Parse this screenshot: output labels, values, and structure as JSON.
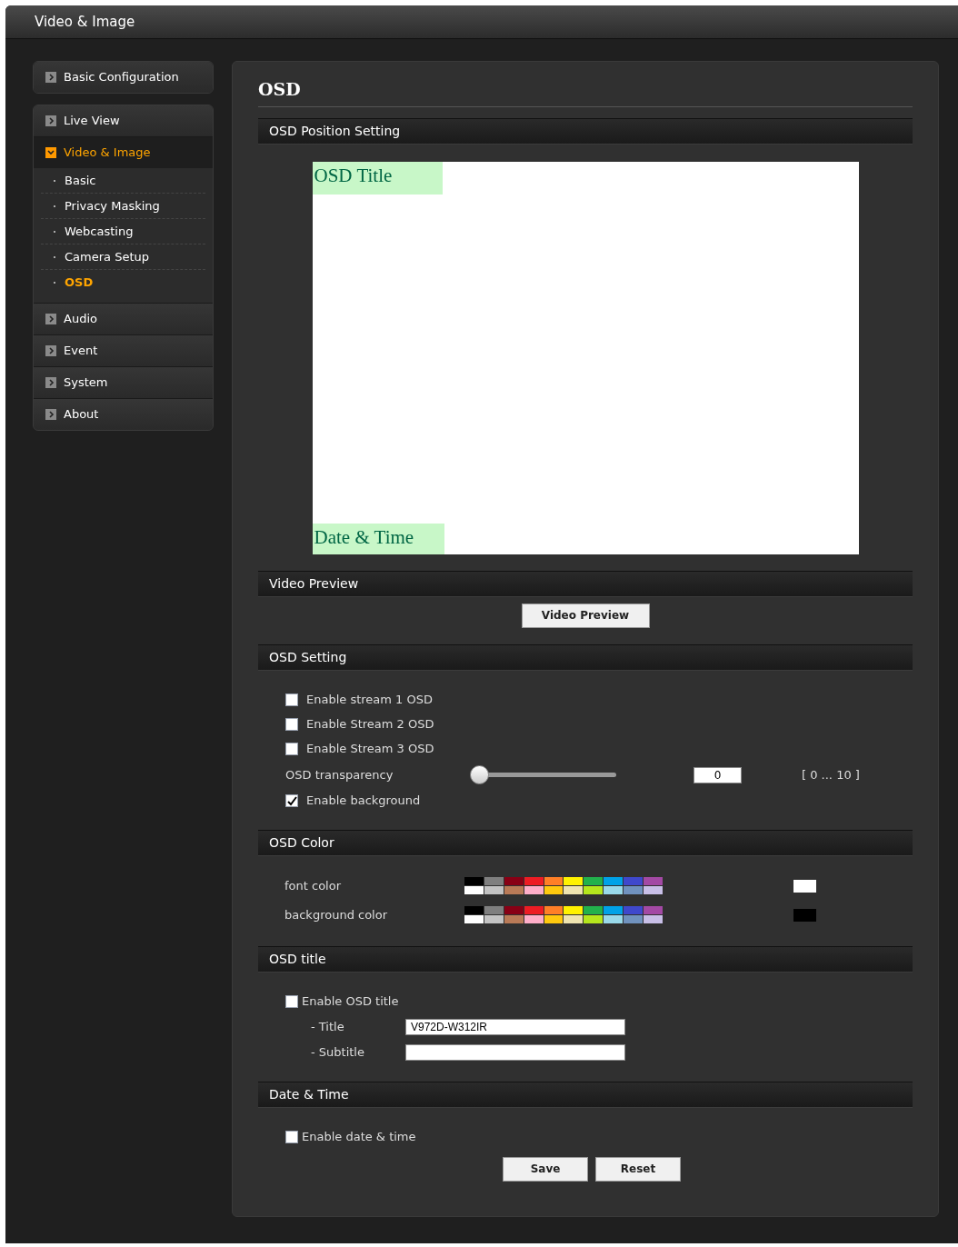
{
  "window": {
    "title": "Video & Image"
  },
  "sidebar": {
    "groups": [
      {
        "items": [
          {
            "label": "Basic Configuration",
            "expanded": false
          }
        ]
      },
      {
        "items": [
          {
            "label": "Live View",
            "expanded": false
          },
          {
            "label": "Video & Image",
            "expanded": true,
            "children": [
              {
                "label": "Basic",
                "selected": false
              },
              {
                "label": "Privacy Masking",
                "selected": false
              },
              {
                "label": "Webcasting",
                "selected": false
              },
              {
                "label": "Camera Setup",
                "selected": false
              },
              {
                "label": "OSD",
                "selected": true
              }
            ]
          },
          {
            "label": "Audio",
            "expanded": false
          },
          {
            "label": "Event",
            "expanded": false
          },
          {
            "label": "System",
            "expanded": false
          },
          {
            "label": "About",
            "expanded": false
          }
        ]
      }
    ]
  },
  "page": {
    "title": "OSD",
    "position": {
      "header": "OSD Position Setting",
      "title_label": "OSD Title",
      "datetime_label": "Date & Time"
    },
    "video_preview": {
      "header": "Video Preview",
      "button": "Video Preview"
    },
    "osd_setting": {
      "header": "OSD Setting",
      "checks": [
        {
          "label": "Enable stream 1 OSD",
          "checked": false
        },
        {
          "label": "Enable Stream 2 OSD",
          "checked": false
        },
        {
          "label": "Enable Stream 3 OSD",
          "checked": false
        }
      ],
      "transparency": {
        "label": "OSD transparency",
        "level": 0,
        "value": "0",
        "range": "[ 0 ... 10 ]"
      },
      "background": {
        "label": "Enable background",
        "checked": true
      }
    },
    "osd_color": {
      "header": "OSD Color",
      "rows": [
        {
          "label": "font color",
          "color": "#ffffff",
          "palette": [
            {
              "color": "#000000"
            },
            {
              "color": "#7f7f7f"
            },
            {
              "color": "#880015"
            },
            {
              "color": "#ed1c24"
            },
            {
              "color": "#ff7f27"
            },
            {
              "color": "#fff200"
            },
            {
              "color": "#22b14c"
            },
            {
              "color": "#00a2e8"
            },
            {
              "color": "#3f48cc"
            },
            {
              "color": "#a349a4"
            },
            {
              "color": "#ffffff"
            },
            {
              "color": "#c3c3c3"
            },
            {
              "color": "#b97a57"
            },
            {
              "color": "#ffaec9"
            },
            {
              "color": "#ffc90e"
            },
            {
              "color": "#efe4b0"
            },
            {
              "color": "#b5e61d"
            },
            {
              "color": "#99d9ea"
            },
            {
              "color": "#7092be"
            },
            {
              "color": "#c8bfe7"
            }
          ]
        },
        {
          "label": "background color",
          "color": "#000000",
          "palette": [
            {
              "color": "#000000"
            },
            {
              "color": "#7f7f7f"
            },
            {
              "color": "#880015"
            },
            {
              "color": "#ed1c24"
            },
            {
              "color": "#ff7f27"
            },
            {
              "color": "#fff200"
            },
            {
              "color": "#22b14c"
            },
            {
              "color": "#00a2e8"
            },
            {
              "color": "#3f48cc"
            },
            {
              "color": "#a349a4"
            },
            {
              "color": "#ffffff"
            },
            {
              "color": "#c3c3c3"
            },
            {
              "color": "#b97a57"
            },
            {
              "color": "#ffaec9"
            },
            {
              "color": "#ffc90e"
            },
            {
              "color": "#efe4b0"
            },
            {
              "color": "#b5e61d"
            },
            {
              "color": "#99d9ea"
            },
            {
              "color": "#7092be"
            },
            {
              "color": "#c8bfe7"
            }
          ]
        }
      ]
    },
    "osd_title": {
      "header": "OSD title",
      "enable": {
        "label": "Enable OSD title",
        "checked": false
      },
      "fields": [
        {
          "label": "- Title",
          "value": "V972D-W312IR"
        },
        {
          "label": "- Subtitle"
        }
      ]
    },
    "date_time": {
      "header": "Date & Time",
      "enable": {
        "label": "Enable date & time",
        "checked": false
      }
    },
    "buttons": [
      "Save",
      "Reset"
    ]
  }
}
